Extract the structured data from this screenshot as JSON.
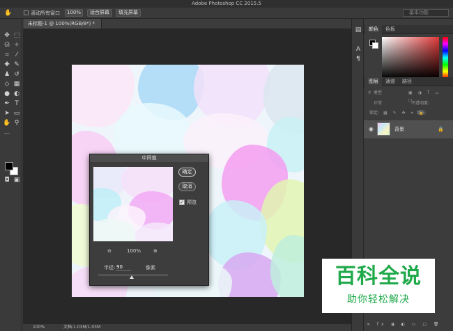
{
  "titlebar": {
    "title": "Adobe Photoshop CC 2015.5"
  },
  "options_bar": {
    "scroll_all_label": "滚动所有窗口",
    "zoom_100_label": "100%",
    "fit_screen_label": "适合屏幕",
    "fill_screen_label": "填充屏幕",
    "workspace_label": "基本功能"
  },
  "document": {
    "tab_label": "未标题-1 @ 100%(RGB/8*) *",
    "status_zoom": "100%",
    "status_doc": "文档:1.03M/1.03M"
  },
  "right_panel": {
    "color_tabs": [
      "颜色",
      "色板"
    ],
    "layer_tabs": [
      "图层",
      "通道",
      "路径"
    ],
    "filter_kind": "类型",
    "blend_mode": "正常",
    "opacity_label": "不透明度:",
    "lock_label": "锁定:",
    "fill_label": "填充:",
    "layer_name": "背景"
  },
  "dialog": {
    "title": "中间值",
    "ok_label": "确定",
    "cancel_label": "取消",
    "preview_label": "预览",
    "preview_checked": true,
    "zoom_value": "100%",
    "radius_label": "半径:",
    "radius_value": "90",
    "radius_unit": "像素"
  },
  "watermark": {
    "title": "百科全说",
    "subtitle": "助你轻松解决"
  },
  "colors": {
    "foreground": "#000000",
    "background": "#ffffff",
    "watermark_green": "#1fa94a"
  }
}
